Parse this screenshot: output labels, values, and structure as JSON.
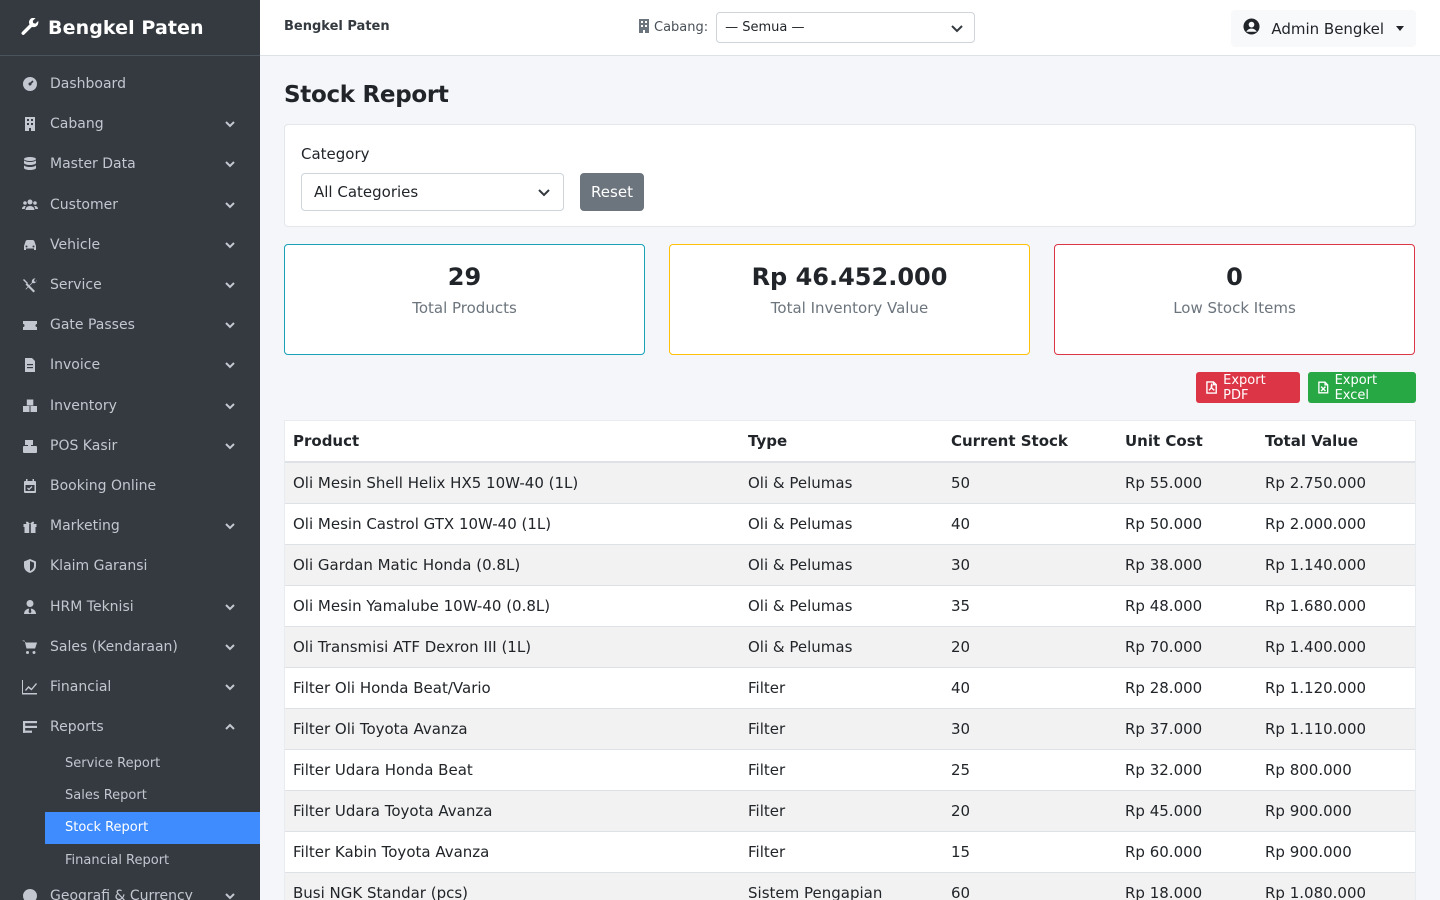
{
  "sidebar": {
    "brand": "Bengkel Paten",
    "items": [
      {
        "label": "Dashboard",
        "icon": "dashboard-icon",
        "has_children": false
      },
      {
        "label": "Cabang",
        "icon": "building-icon",
        "has_children": true
      },
      {
        "label": "Master Data",
        "icon": "database-icon",
        "has_children": true
      },
      {
        "label": "Customer",
        "icon": "users-icon",
        "has_children": true
      },
      {
        "label": "Vehicle",
        "icon": "car-icon",
        "has_children": true
      },
      {
        "label": "Service",
        "icon": "tools-icon",
        "has_children": true
      },
      {
        "label": "Gate Passes",
        "icon": "ticket-icon",
        "has_children": true
      },
      {
        "label": "Invoice",
        "icon": "invoice-icon",
        "has_children": true
      },
      {
        "label": "Inventory",
        "icon": "boxes-icon",
        "has_children": true
      },
      {
        "label": "POS Kasir",
        "icon": "cash-register-icon",
        "has_children": true
      },
      {
        "label": "Booking Online",
        "icon": "calendar-icon",
        "has_children": false
      },
      {
        "label": "Marketing",
        "icon": "gift-icon",
        "has_children": true
      },
      {
        "label": "Klaim Garansi",
        "icon": "shield-icon",
        "has_children": false
      },
      {
        "label": "HRM Teknisi",
        "icon": "user-tie-icon",
        "has_children": true
      },
      {
        "label": "Sales (Kendaraan)",
        "icon": "cart-icon",
        "has_children": true
      },
      {
        "label": "Financial",
        "icon": "chart-line-icon",
        "has_children": true
      },
      {
        "label": "Reports",
        "icon": "reports-icon",
        "has_children": true,
        "expanded": true
      }
    ],
    "reports_sub": [
      {
        "label": "Service Report",
        "active": false
      },
      {
        "label": "Sales Report",
        "active": false
      },
      {
        "label": "Stock Report",
        "active": true
      },
      {
        "label": "Financial Report",
        "active": false
      }
    ],
    "last_item": {
      "label": "Geografi & Currency",
      "icon": "globe-icon"
    }
  },
  "topbar": {
    "title": "Bengkel Paten",
    "branch_label": "Cabang:",
    "branch_value": "— Semua —",
    "user_name": "Admin Bengkel"
  },
  "page": {
    "title": "Stock Report",
    "filter": {
      "category_label": "Category",
      "category_value": "All Categories",
      "reset_label": "Reset"
    },
    "stats": [
      {
        "value": "29",
        "label": "Total Products"
      },
      {
        "value": "Rp 46.452.000",
        "label": "Total Inventory Value"
      },
      {
        "value": "0",
        "label": "Low Stock Items"
      }
    ],
    "export_pdf": "Export PDF",
    "export_excel": "Export Excel"
  },
  "table": {
    "headers": [
      "Product",
      "Type",
      "Current Stock",
      "Unit Cost",
      "Total Value"
    ],
    "rows": [
      [
        "Oli Mesin Shell Helix HX5 10W-40 (1L)",
        "Oli & Pelumas",
        "50",
        "Rp 55.000",
        "Rp 2.750.000"
      ],
      [
        "Oli Mesin Castrol GTX 10W-40 (1L)",
        "Oli & Pelumas",
        "40",
        "Rp 50.000",
        "Rp 2.000.000"
      ],
      [
        "Oli Gardan Matic Honda (0.8L)",
        "Oli & Pelumas",
        "30",
        "Rp 38.000",
        "Rp 1.140.000"
      ],
      [
        "Oli Mesin Yamalube 10W-40 (0.8L)",
        "Oli & Pelumas",
        "35",
        "Rp 48.000",
        "Rp 1.680.000"
      ],
      [
        "Oli Transmisi ATF Dexron III (1L)",
        "Oli & Pelumas",
        "20",
        "Rp 70.000",
        "Rp 1.400.000"
      ],
      [
        "Filter Oli Honda Beat/Vario",
        "Filter",
        "40",
        "Rp 28.000",
        "Rp 1.120.000"
      ],
      [
        "Filter Oli Toyota Avanza",
        "Filter",
        "30",
        "Rp 37.000",
        "Rp 1.110.000"
      ],
      [
        "Filter Udara Honda Beat",
        "Filter",
        "25",
        "Rp 32.000",
        "Rp 800.000"
      ],
      [
        "Filter Udara Toyota Avanza",
        "Filter",
        "20",
        "Rp 45.000",
        "Rp 900.000"
      ],
      [
        "Filter Kabin Toyota Avanza",
        "Filter",
        "15",
        "Rp 60.000",
        "Rp 900.000"
      ],
      [
        "Busi NGK Standar (pcs)",
        "Sistem Pengapian",
        "60",
        "Rp 18.000",
        "Rp 1.080.000"
      ]
    ]
  }
}
